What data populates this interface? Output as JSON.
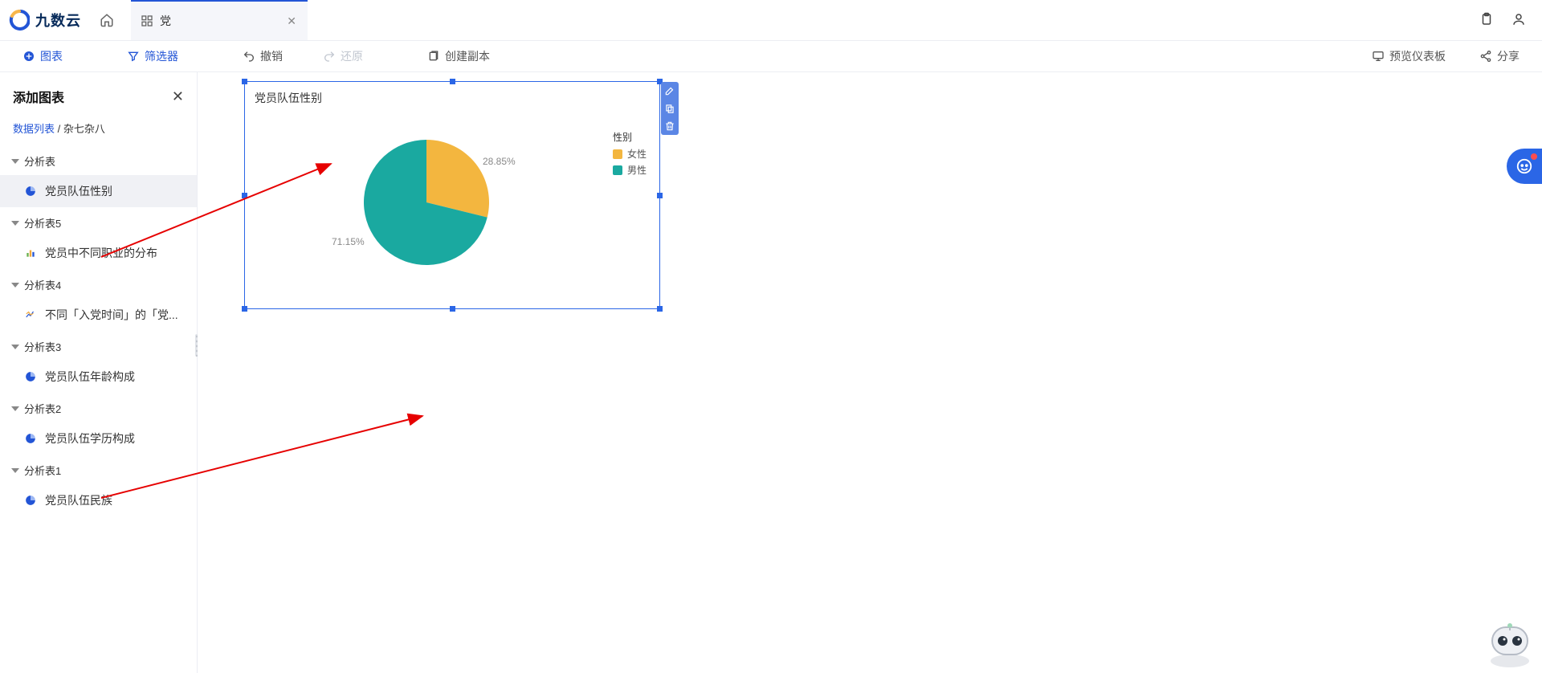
{
  "app": {
    "name": "九数云"
  },
  "tab": {
    "title": "党"
  },
  "toolbar": {
    "chart": "图表",
    "filter": "筛选器",
    "undo": "撤销",
    "redo": "还原",
    "copy": "创建副本",
    "preview": "预览仪表板",
    "share": "分享"
  },
  "sidebar": {
    "title": "添加图表",
    "crumb_link": "数据列表",
    "crumb_sep": " / ",
    "crumb_current": "杂七杂八",
    "groups": [
      {
        "head": "分析表",
        "items": [
          {
            "label": "党员队伍性别",
            "icon": "pie",
            "active": true
          }
        ]
      },
      {
        "head": "分析表5",
        "items": [
          {
            "label": "党员中不同职业的分布",
            "icon": "bar"
          }
        ]
      },
      {
        "head": "分析表4",
        "items": [
          {
            "label": "不同「入党时间」的「党...",
            "icon": "line"
          }
        ]
      },
      {
        "head": "分析表3",
        "items": [
          {
            "label": "党员队伍年龄构成",
            "icon": "pie"
          }
        ]
      },
      {
        "head": "分析表2",
        "items": [
          {
            "label": "党员队伍学历构成",
            "icon": "pie"
          }
        ]
      },
      {
        "head": "分析表1",
        "items": [
          {
            "label": "党员队伍民族",
            "icon": "pie"
          }
        ]
      }
    ]
  },
  "chart": {
    "title": "党员队伍性别",
    "legend_title": "性别"
  },
  "chart_data": {
    "type": "pie",
    "title": "党员队伍性别",
    "series": [
      {
        "name": "女性",
        "value": 28.85,
        "color": "#f3b63f",
        "label": "28.85%"
      },
      {
        "name": "男性",
        "value": 71.15,
        "color": "#1aa9a0",
        "label": "71.15%"
      }
    ]
  }
}
